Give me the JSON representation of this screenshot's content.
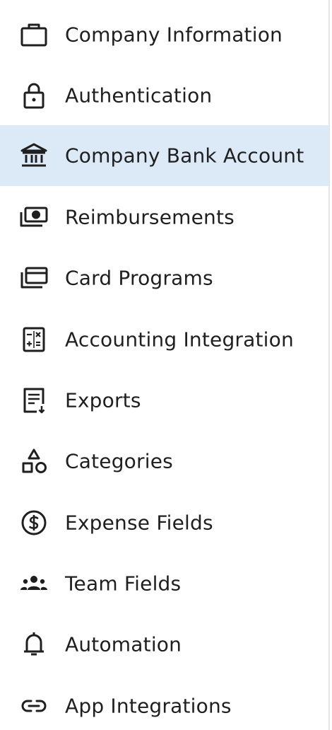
{
  "colors": {
    "active_background": "#dceaf7",
    "text": "#1f1f1f",
    "icon": "#1f1f1f"
  },
  "sidebar": {
    "active_item": "Company Bank Account",
    "items": [
      {
        "label": "Company Information",
        "icon": "briefcase-icon"
      },
      {
        "label": "Authentication",
        "icon": "lock-icon"
      },
      {
        "label": "Company Bank Account",
        "icon": "bank-icon"
      },
      {
        "label": "Reimbursements",
        "icon": "money-icon"
      },
      {
        "label": "Card Programs",
        "icon": "cards-icon"
      },
      {
        "label": "Accounting Integration",
        "icon": "calculator-icon"
      },
      {
        "label": "Exports",
        "icon": "export-document-icon"
      },
      {
        "label": "Categories",
        "icon": "shapes-icon"
      },
      {
        "label": "Expense Fields",
        "icon": "dollar-circle-icon"
      },
      {
        "label": "Team Fields",
        "icon": "team-icon"
      },
      {
        "label": "Automation",
        "icon": "bell-icon"
      },
      {
        "label": "App Integrations",
        "icon": "link-icon"
      }
    ]
  }
}
